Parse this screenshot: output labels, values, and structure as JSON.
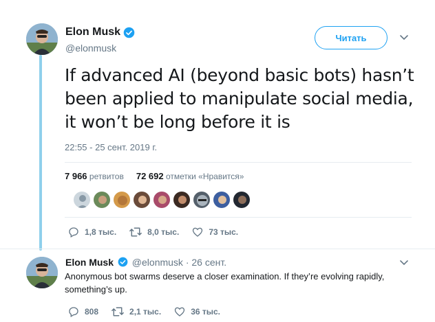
{
  "tweet": {
    "author_name": "Elon Musk",
    "handle": "@elonmusk",
    "follow_label": "Читать",
    "text": "If advanced AI (beyond basic bots) hasn’t been applied to manipulate social media, it won’t be long before it is",
    "timestamp": "22:55 - 25 сент. 2019 г.",
    "retweets_count": "7 966",
    "retweets_label": "ретвитов",
    "likes_count": "72 692",
    "likes_label": "отметки «Нравится»",
    "replies": "1,8 тыс.",
    "retweets_short": "8,0 тыс.",
    "likes_short": "73 тыс."
  },
  "reply": {
    "author_name": "Elon Musk",
    "handle_date": "@elonmusk · 26 сент.",
    "text": "Anonymous bot swarms deserve a closer examination. If they’re evolving rapidly, something’s up.",
    "replies": "808",
    "retweets": "2,1 тыс.",
    "likes": "36 тыс."
  },
  "colors": {
    "accent": "#1da1f2",
    "thread_line": "#8fd0ec",
    "secondary_text": "#657786"
  },
  "icons": [
    "verified-badge-icon",
    "chevron-down-icon",
    "reply-icon",
    "retweet-icon",
    "heart-icon"
  ]
}
